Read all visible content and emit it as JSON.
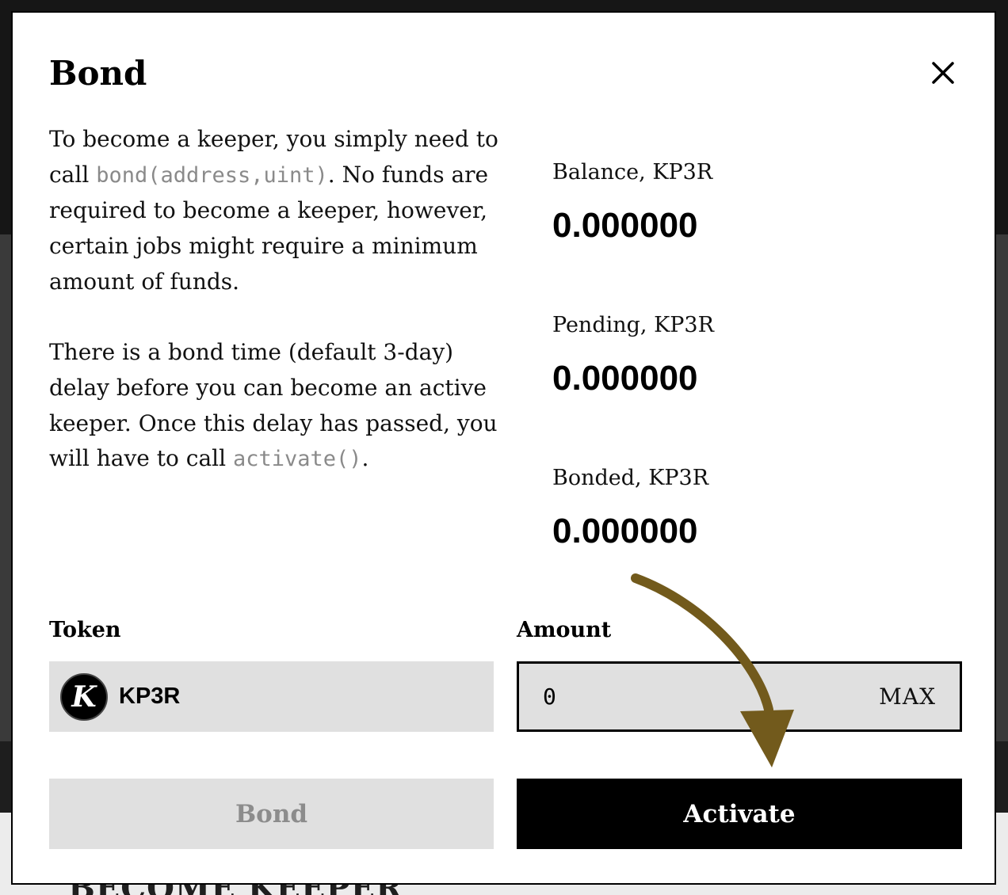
{
  "background": {
    "heading": "BECOME KEEPER"
  },
  "modal": {
    "title": "Bond",
    "description": {
      "p1_before": "To become a keeper, you simply need to call ",
      "p1_code": "bond(address,uint)",
      "p1_after": ". No funds are required to become a keeper, however, certain jobs might require a minimum amount of funds.",
      "p2_before": "There is a bond time (default 3-day) delay before you can become an active keeper. Once this delay has passed, you will have to call ",
      "p2_code": "activate()",
      "p2_after": "."
    },
    "stats": [
      {
        "label": "Balance, KP3R",
        "value": "0.000000"
      },
      {
        "label": "Pending, KP3R",
        "value": "0.000000"
      },
      {
        "label": "Bonded, KP3R",
        "value": "0.000000"
      }
    ],
    "token": {
      "label": "Token",
      "logo_letter": "K",
      "name": "KP3R"
    },
    "amount": {
      "label": "Amount",
      "value": "0",
      "max_label": "MAX"
    },
    "buttons": {
      "bond": "Bond",
      "activate": "Activate"
    }
  },
  "colors": {
    "arrow": "#725a1c",
    "muted": "#8c8c8c",
    "field_bg": "#e0e0e0"
  },
  "icons": {
    "close": "close-icon",
    "token_logo": "kp3r-logo-icon",
    "annotation": "arrow-annotation-icon"
  }
}
